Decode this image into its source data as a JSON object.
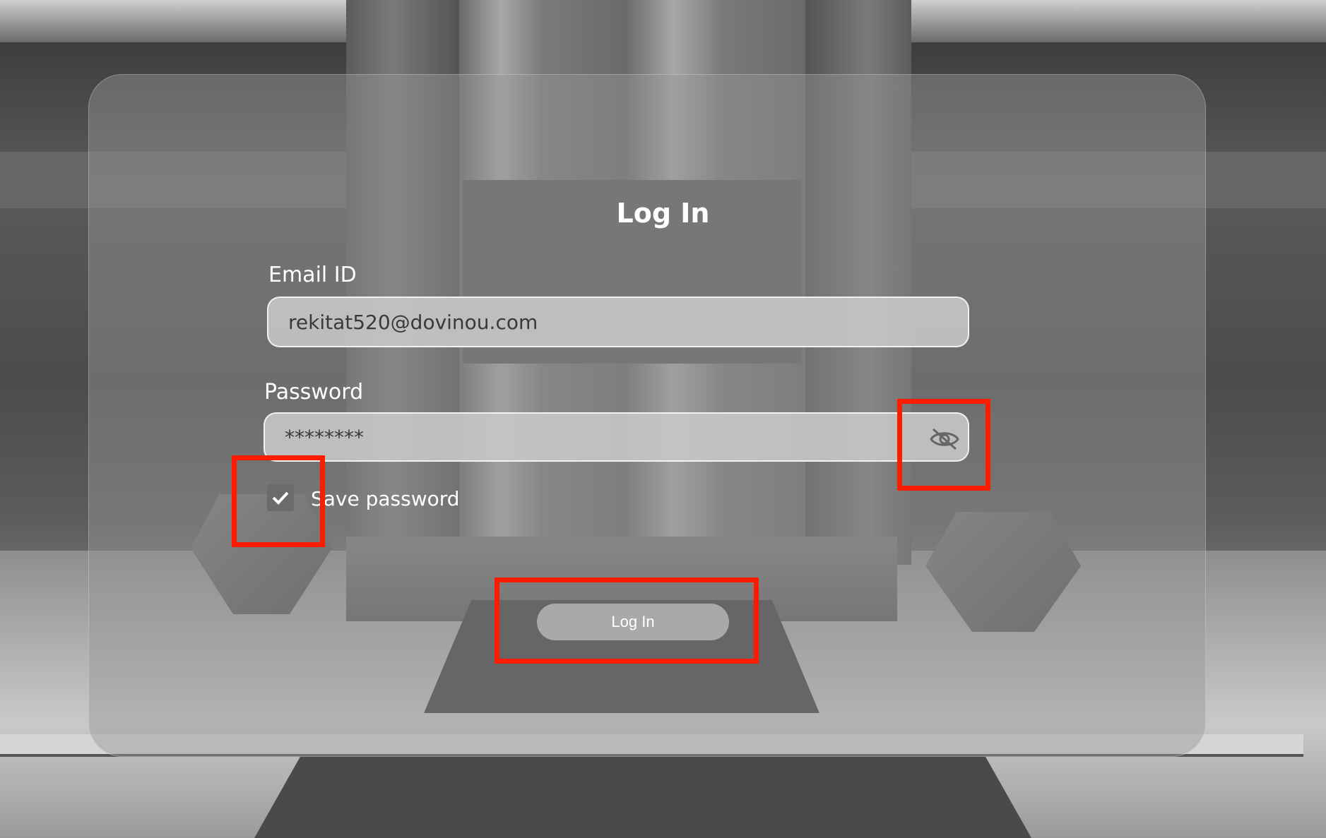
{
  "login": {
    "title": "Log In",
    "email": {
      "label": "Email ID",
      "value": "rekitat520@dovinou.com"
    },
    "password": {
      "label": "Password",
      "value": "********",
      "visibility_icon": "eye-off-icon"
    },
    "save_password": {
      "label": "Save password",
      "checked": true,
      "check_icon": "checkmark-icon"
    },
    "submit_label": "Log In"
  },
  "colors": {
    "highlight": "#ff1a00",
    "text": "#ffffff",
    "field_bg": "#c8c8c8"
  }
}
